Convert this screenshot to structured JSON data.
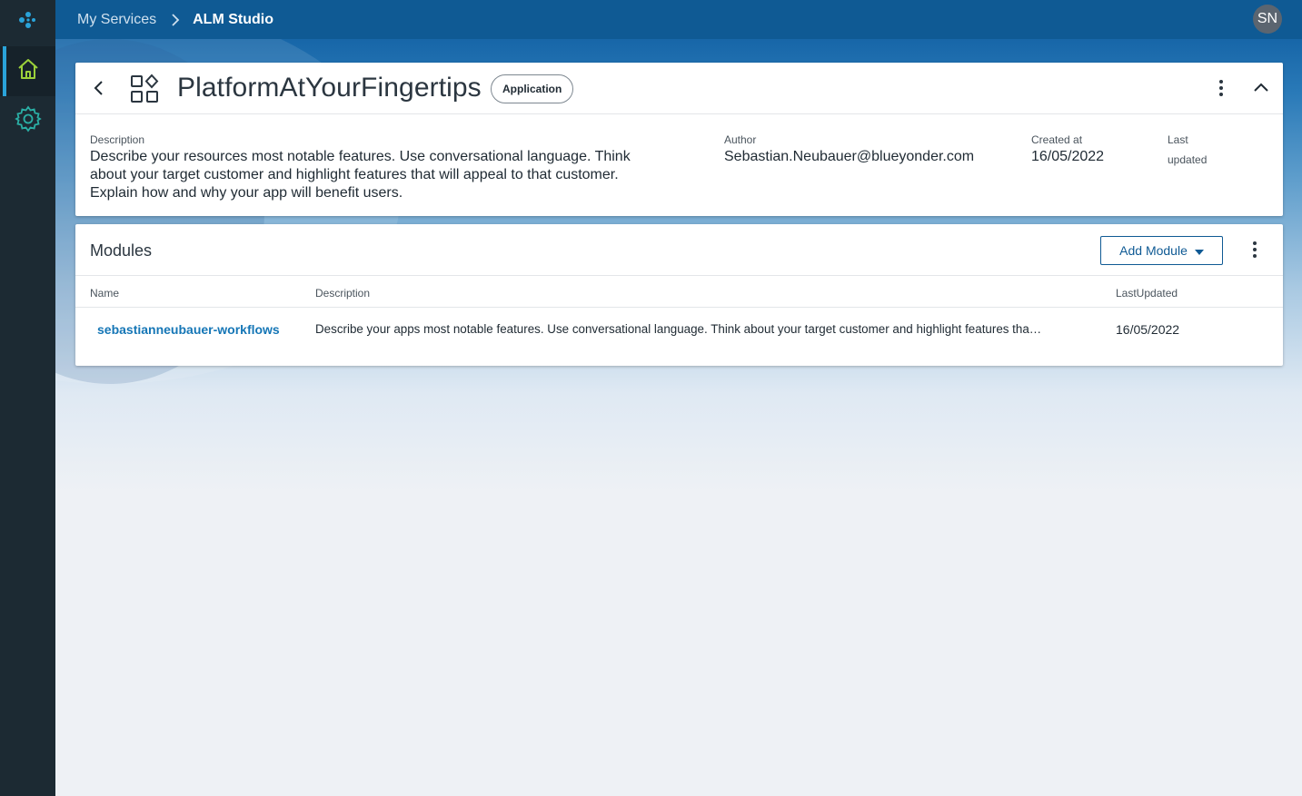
{
  "breadcrumb": {
    "parent": "My Services",
    "current": "ALM Studio"
  },
  "user": {
    "initials": "SN"
  },
  "app": {
    "title": "PlatformAtYourFingertips",
    "badge": "Application",
    "description_label": "Description",
    "description_lines": [
      "Describe your resources most notable features. Use conversational language. Think",
      "about your target customer and highlight features that will appeal to that customer.",
      "Explain how and why your app will benefit users."
    ],
    "author_label": "Author",
    "author": "Sebastian.Neubauer@blueyonder.com",
    "created_label": "Created at",
    "created": "16/05/2022",
    "updated_label_line1": "Last",
    "updated_label_line2": "updated"
  },
  "modules": {
    "title": "Modules",
    "add_button": "Add Module",
    "columns": {
      "name": "Name",
      "description": "Description",
      "last_updated": "LastUpdated"
    },
    "rows": [
      {
        "name": "sebastianneubauer-workflows",
        "description": "Describe your apps most notable features. Use conversational language. Think about your target customer and highlight features tha…",
        "last_updated": "16/05/2022"
      }
    ]
  },
  "colors": {
    "rail": "#1c2a33",
    "topbar": "#0f5a94",
    "accent": "#2aa3d9",
    "home_icon": "#9bd13a",
    "settings_icon": "#2ab0a6",
    "link": "#1576b6"
  },
  "icons": {
    "logo": "brand-logo-icon",
    "home": "home-icon",
    "settings": "gear-icon",
    "back": "chevron-left-icon",
    "apps": "apps-grid-icon",
    "more": "kebab-icon",
    "collapse": "chevron-up-icon",
    "dropdown": "caret-down-icon",
    "breadcrumb_sep": "chevron-right-icon"
  }
}
